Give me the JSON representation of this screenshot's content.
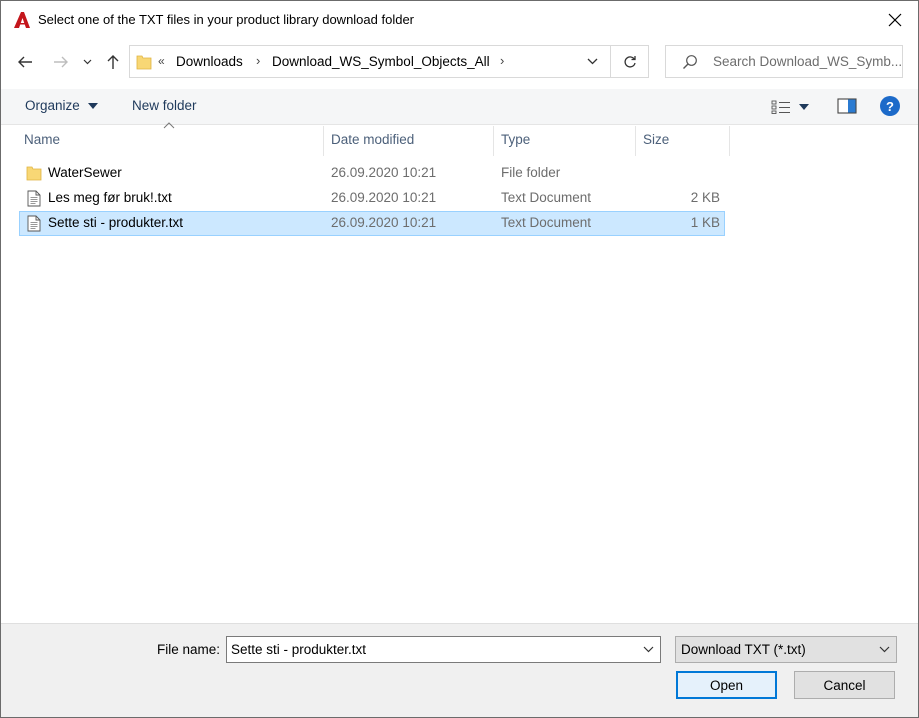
{
  "window": {
    "title": "Select one of the TXT files in your product library download folder"
  },
  "address": {
    "overflow_glyph": "«",
    "crumbs": [
      "Downloads",
      "Download_WS_Symbol_Objects_All"
    ],
    "separator": "›"
  },
  "search": {
    "placeholder": "Search Download_WS_Symb..."
  },
  "toolbar": {
    "organize_label": "Organize",
    "new_folder_label": "New folder"
  },
  "columns": {
    "name": "Name",
    "date_modified": "Date modified",
    "type": "Type",
    "size": "Size"
  },
  "files": [
    {
      "name": "WaterSewer",
      "date": "26.09.2020 10:21",
      "type": "File folder",
      "size": "",
      "icon": "folder-icon",
      "selected": false
    },
    {
      "name": "Les meg før bruk!.txt",
      "date": "26.09.2020 10:21",
      "type": "Text Document",
      "size": "2 KB",
      "icon": "text-file-icon",
      "selected": false
    },
    {
      "name": "Sette sti - produkter.txt",
      "date": "26.09.2020 10:21",
      "type": "Text Document",
      "size": "1 KB",
      "icon": "text-file-icon",
      "selected": true
    }
  ],
  "bottom": {
    "filename_label": "File name:",
    "filename_value": "Sette sti - produkter.txt",
    "filetype_value": "Download TXT (*.txt)",
    "open_label": "Open",
    "cancel_label": "Cancel"
  },
  "colors": {
    "selection_bg": "#cce8ff",
    "selection_border": "#99d1ff",
    "accent": "#0078d7",
    "app_icon_red": "#c4161c",
    "help_blue": "#1c6ac9"
  }
}
